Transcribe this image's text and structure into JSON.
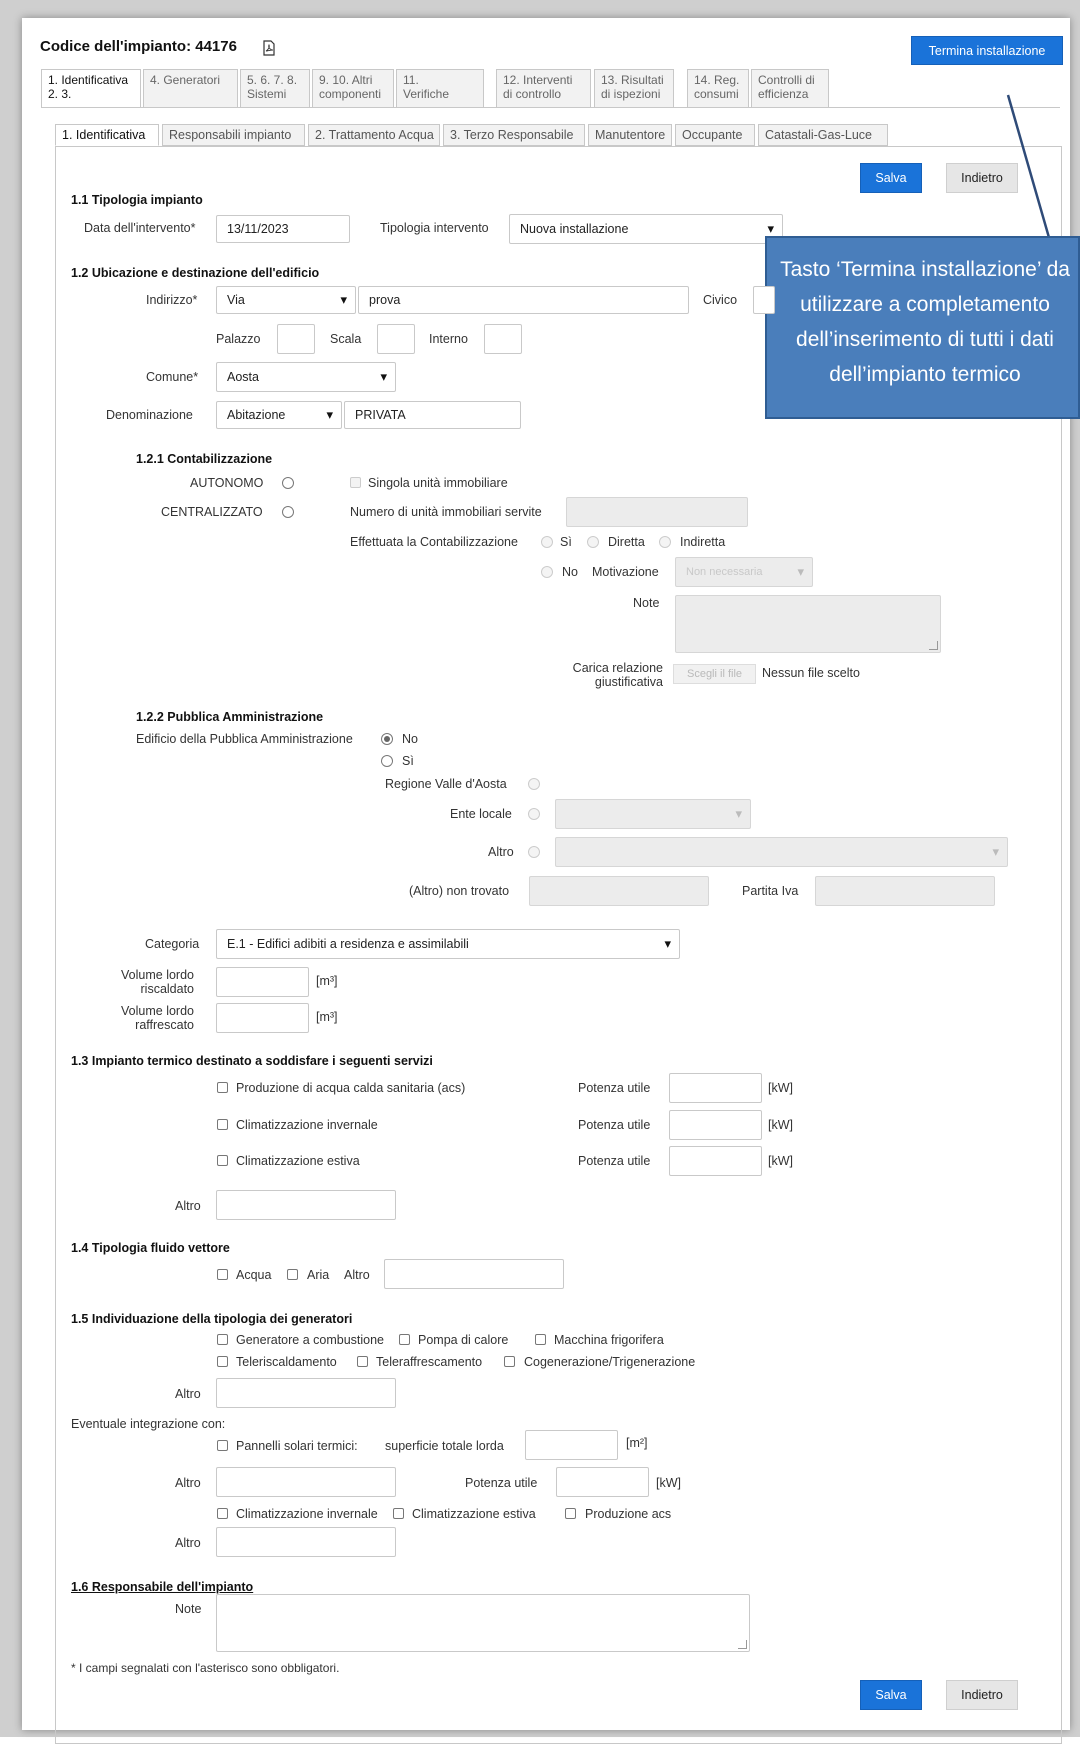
{
  "header": {
    "title": "Codice dell'impianto: 44176",
    "finish_button": "Termina installazione"
  },
  "main_tabs": [
    {
      "line1": "1. Identificativa",
      "line2": "2. 3."
    },
    {
      "line1": "",
      "line2": "4. Generatori"
    },
    {
      "line1": "5. 6. 7. 8.",
      "line2": "Sistemi"
    },
    {
      "line1": "9. 10. Altri",
      "line2": "componenti"
    },
    {
      "line1": "11.",
      "line2": "Verifiche"
    },
    {
      "line1": "12. Interventi",
      "line2": "di controllo"
    },
    {
      "line1": "13. Risultati",
      "line2": "di ispezioni"
    },
    {
      "line1": "14. Reg.",
      "line2": "consumi"
    },
    {
      "line1": "Controlli di",
      "line2": "efficienza"
    }
  ],
  "sub_tabs": [
    "1. Identificativa",
    "Responsabili impianto",
    "2. Trattamento Acqua",
    "3. Terzo Responsabile",
    "Manutentore",
    "Occupante",
    "Catastali-Gas-Luce"
  ],
  "actions": {
    "save": "Salva",
    "back": "Indietro"
  },
  "s11": {
    "title": "1.1 Tipologia impianto",
    "date_label": "Data dell'intervento*",
    "date_value": "13/11/2023",
    "type_label": "Tipologia intervento",
    "type_value": "Nuova installazione"
  },
  "s12": {
    "title": "1.2 Ubicazione e destinazione dell'edificio",
    "address_label": "Indirizzo*",
    "address_type": "Via",
    "address_value": "prova",
    "civico_label": "Civico",
    "palazzo_label": "Palazzo",
    "scala_label": "Scala",
    "interno_label": "Interno",
    "comune_label": "Comune*",
    "comune_value": "Aosta",
    "denominazione_label": "Denominazione",
    "denominazione_type": "Abitazione",
    "denominazione_value": "PRIVATA"
  },
  "s121": {
    "title": "1.2.1 Contabilizzazione",
    "autonomo": "AUTONOMO",
    "centralizzato": "CENTRALIZZATO",
    "singola": "Singola unità immobiliare",
    "numero": "Numero di unità immobiliari servite",
    "effettuata": "Effettuata la Contabilizzazione",
    "si": "Sì",
    "diretta": "Diretta",
    "indiretta": "Indiretta",
    "no": "No",
    "motivazione": "Motivazione",
    "motivazione_value": "Non necessaria",
    "note": "Note",
    "carica_1": "Carica relazione",
    "carica_2": "giustificativa",
    "file_button": "Scegli il file",
    "file_status": "Nessun file scelto"
  },
  "s122": {
    "title": "1.2.2 Pubblica Amministrazione",
    "edificio": "Edificio della Pubblica Amministrazione",
    "no": "No",
    "si": "Sì",
    "regione": "Regione Valle d'Aosta",
    "ente": "Ente locale",
    "altro": "Altro",
    "non_trovato": "(Altro) non trovato",
    "partita_iva": "Partita Iva"
  },
  "categoria": {
    "label": "Categoria",
    "value": "E.1 - Edifici adibiti a residenza e assimilabili",
    "vol_risc_1": "Volume lordo",
    "vol_risc_2": "riscaldato",
    "vol_raff_1": "Volume lordo",
    "vol_raff_2": "raffrescato",
    "unit_m3": "[m³]"
  },
  "s13": {
    "title": "1.3 Impianto termico destinato a soddisfare i seguenti servizi",
    "items": [
      {
        "label": "Produzione di acqua calda sanitaria (acs)",
        "potenza": "Potenza utile",
        "unit": "[kW]"
      },
      {
        "label": "Climatizzazione invernale",
        "potenza": "Potenza utile",
        "unit": "[kW]"
      },
      {
        "label": "Climatizzazione estiva",
        "potenza": "Potenza utile",
        "unit": "[kW]"
      }
    ],
    "altro": "Altro"
  },
  "s14": {
    "title": "1.4 Tipologia fluido vettore",
    "acqua": "Acqua",
    "aria": "Aria",
    "altro": "Altro"
  },
  "s15": {
    "title": "1.5 Individuazione della tipologia dei generatori",
    "gen": [
      "Generatore a combustione",
      "Pompa di calore",
      "Macchina frigorifera",
      "Teleriscaldamento",
      "Teleraffrescamento",
      "Cogenerazione/Trigenerazione"
    ],
    "altro": "Altro",
    "integrazione": "Eventuale integrazione con:",
    "pannelli": "Pannelli solari termici:",
    "superficie": "superficie totale lorda",
    "unit_m2": "[m²]",
    "potenza": "Potenza utile",
    "unit_kw": "[kW]",
    "clim": [
      "Climatizzazione invernale",
      "Climatizzazione estiva",
      "Produzione acs"
    ]
  },
  "s16": {
    "title": "1.6 Responsabile dell'impianto",
    "note": "Note"
  },
  "footnote": "* I campi segnalati con l'asterisco sono obbligatori.",
  "callout": {
    "lines": [
      "Tasto ‘Termina installazione’ da",
      "utilizzare a completamento",
      "dell’inserimento di tutti i dati",
      "dell’impianto termico"
    ]
  }
}
